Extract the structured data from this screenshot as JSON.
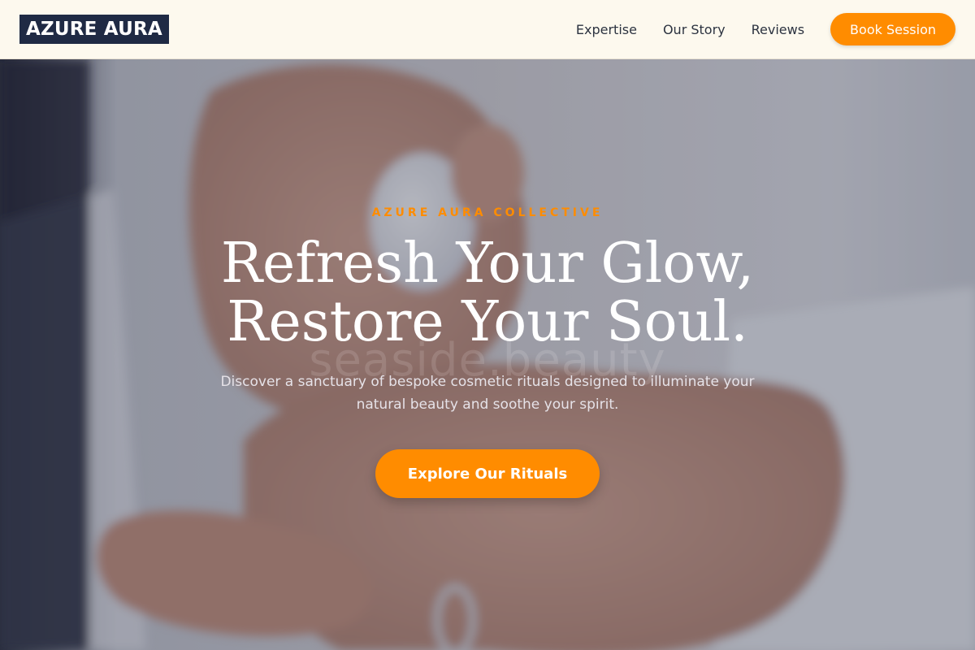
{
  "header": {
    "logo": "AZURE AURA",
    "nav": [
      {
        "label": "Expertise"
      },
      {
        "label": "Our Story"
      },
      {
        "label": "Reviews"
      }
    ],
    "book_button": "Book Session"
  },
  "hero": {
    "eyebrow": "AZURE AURA COLLECTIVE",
    "headline_line1": "Refresh Your Glow,",
    "headline_line2": "Restore Your Soul.",
    "watermark": "seaside.beauty",
    "subtext": "Discover a sanctuary of bespoke cosmetic rituals designed to illuminate your natural beauty and soothe your spirit.",
    "cta": "Explore Our Rituals",
    "image_icon": "hands-holding-cream-jar-photo"
  },
  "colors": {
    "accent": "#ff8c00",
    "logo_bg": "#1f2a44",
    "header_bg": "#fdf9ee"
  }
}
